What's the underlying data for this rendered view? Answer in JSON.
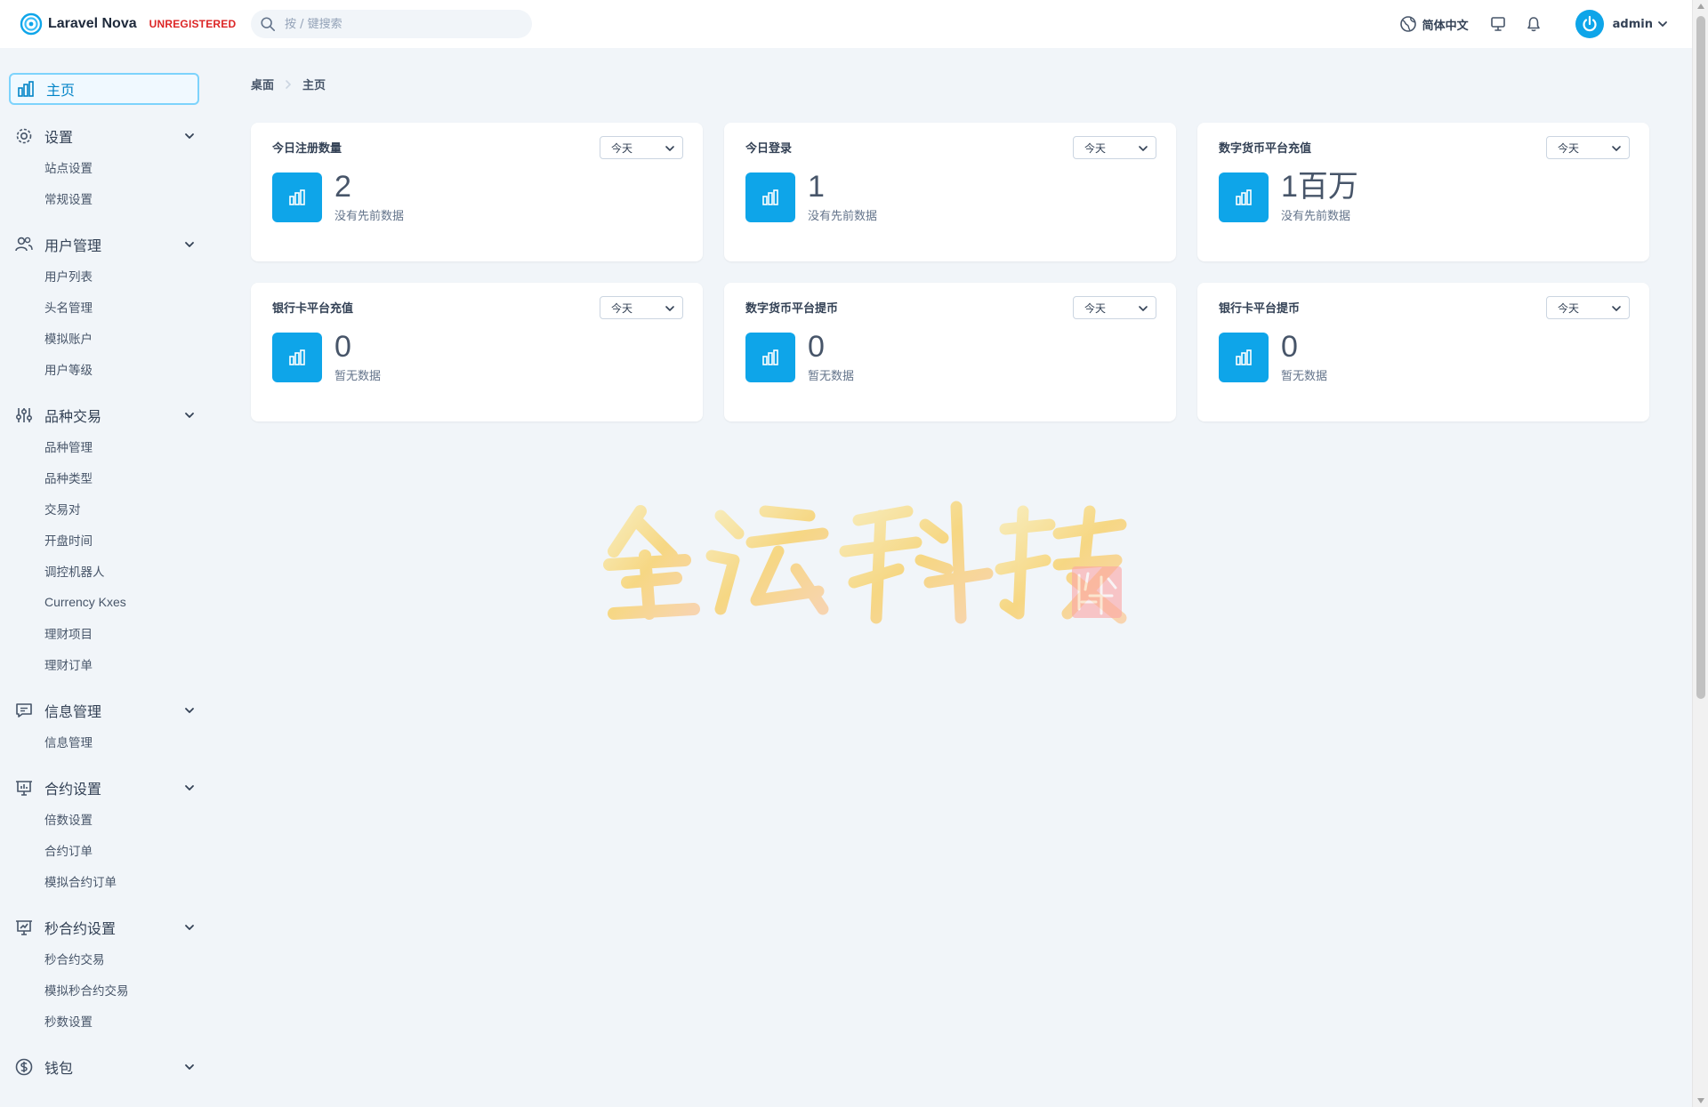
{
  "header": {
    "brand_name": "Laravel Nova",
    "brand_badge": "UNREGISTERED",
    "search_placeholder": "按 / 键搜索",
    "language": "简体中文",
    "user_name": "admin"
  },
  "colors": {
    "accent": "#0ea5e9",
    "badge": "#dc2626",
    "background": "#f1f5f9"
  },
  "sidebar": {
    "home_label": "主页",
    "groups": [
      {
        "label": "设置",
        "icon": "gear-icon",
        "items": [
          "站点设置",
          "常规设置"
        ]
      },
      {
        "label": "用户管理",
        "icon": "users-icon",
        "items": [
          "用户列表",
          "头名管理",
          "模拟账户",
          "用户等级"
        ]
      },
      {
        "label": "品种交易",
        "icon": "sliders-icon",
        "items": [
          "品种管理",
          "品种类型",
          "交易对",
          "开盘时间",
          "调控机器人",
          "Currency Kxes",
          "理财项目",
          "理财订单"
        ]
      },
      {
        "label": "信息管理",
        "icon": "chat-icon",
        "items": [
          "信息管理"
        ]
      },
      {
        "label": "合约设置",
        "icon": "presentation-chart-icon",
        "items": [
          "倍数设置",
          "合约订单",
          "模拟合约订单"
        ]
      },
      {
        "label": "秒合约设置",
        "icon": "presentation-trend-icon",
        "items": [
          "秒合约交易",
          "模拟秒合约交易",
          "秒数设置"
        ]
      },
      {
        "label": "钱包",
        "icon": "currency-icon",
        "items": []
      }
    ]
  },
  "breadcrumb": [
    "桌面",
    "主页"
  ],
  "cards": [
    {
      "title": "今日注册数量",
      "range": "今天",
      "value": "2",
      "note": "没有先前数据"
    },
    {
      "title": "今日登录",
      "range": "今天",
      "value": "1",
      "note": "没有先前数据"
    },
    {
      "title": "数字货币平台充值",
      "range": "今天",
      "value": "1百万",
      "note": "没有先前数据"
    },
    {
      "title": "银行卡平台充值",
      "range": "今天",
      "value": "0",
      "note": "暂无数据"
    },
    {
      "title": "数字货币平台提币",
      "range": "今天",
      "value": "0",
      "note": "暂无数据"
    },
    {
      "title": "银行卡平台提币",
      "range": "今天",
      "value": "0",
      "note": "暂无数据"
    }
  ],
  "watermark": {
    "text": "金话科技",
    "seal_text": "信心保障"
  }
}
